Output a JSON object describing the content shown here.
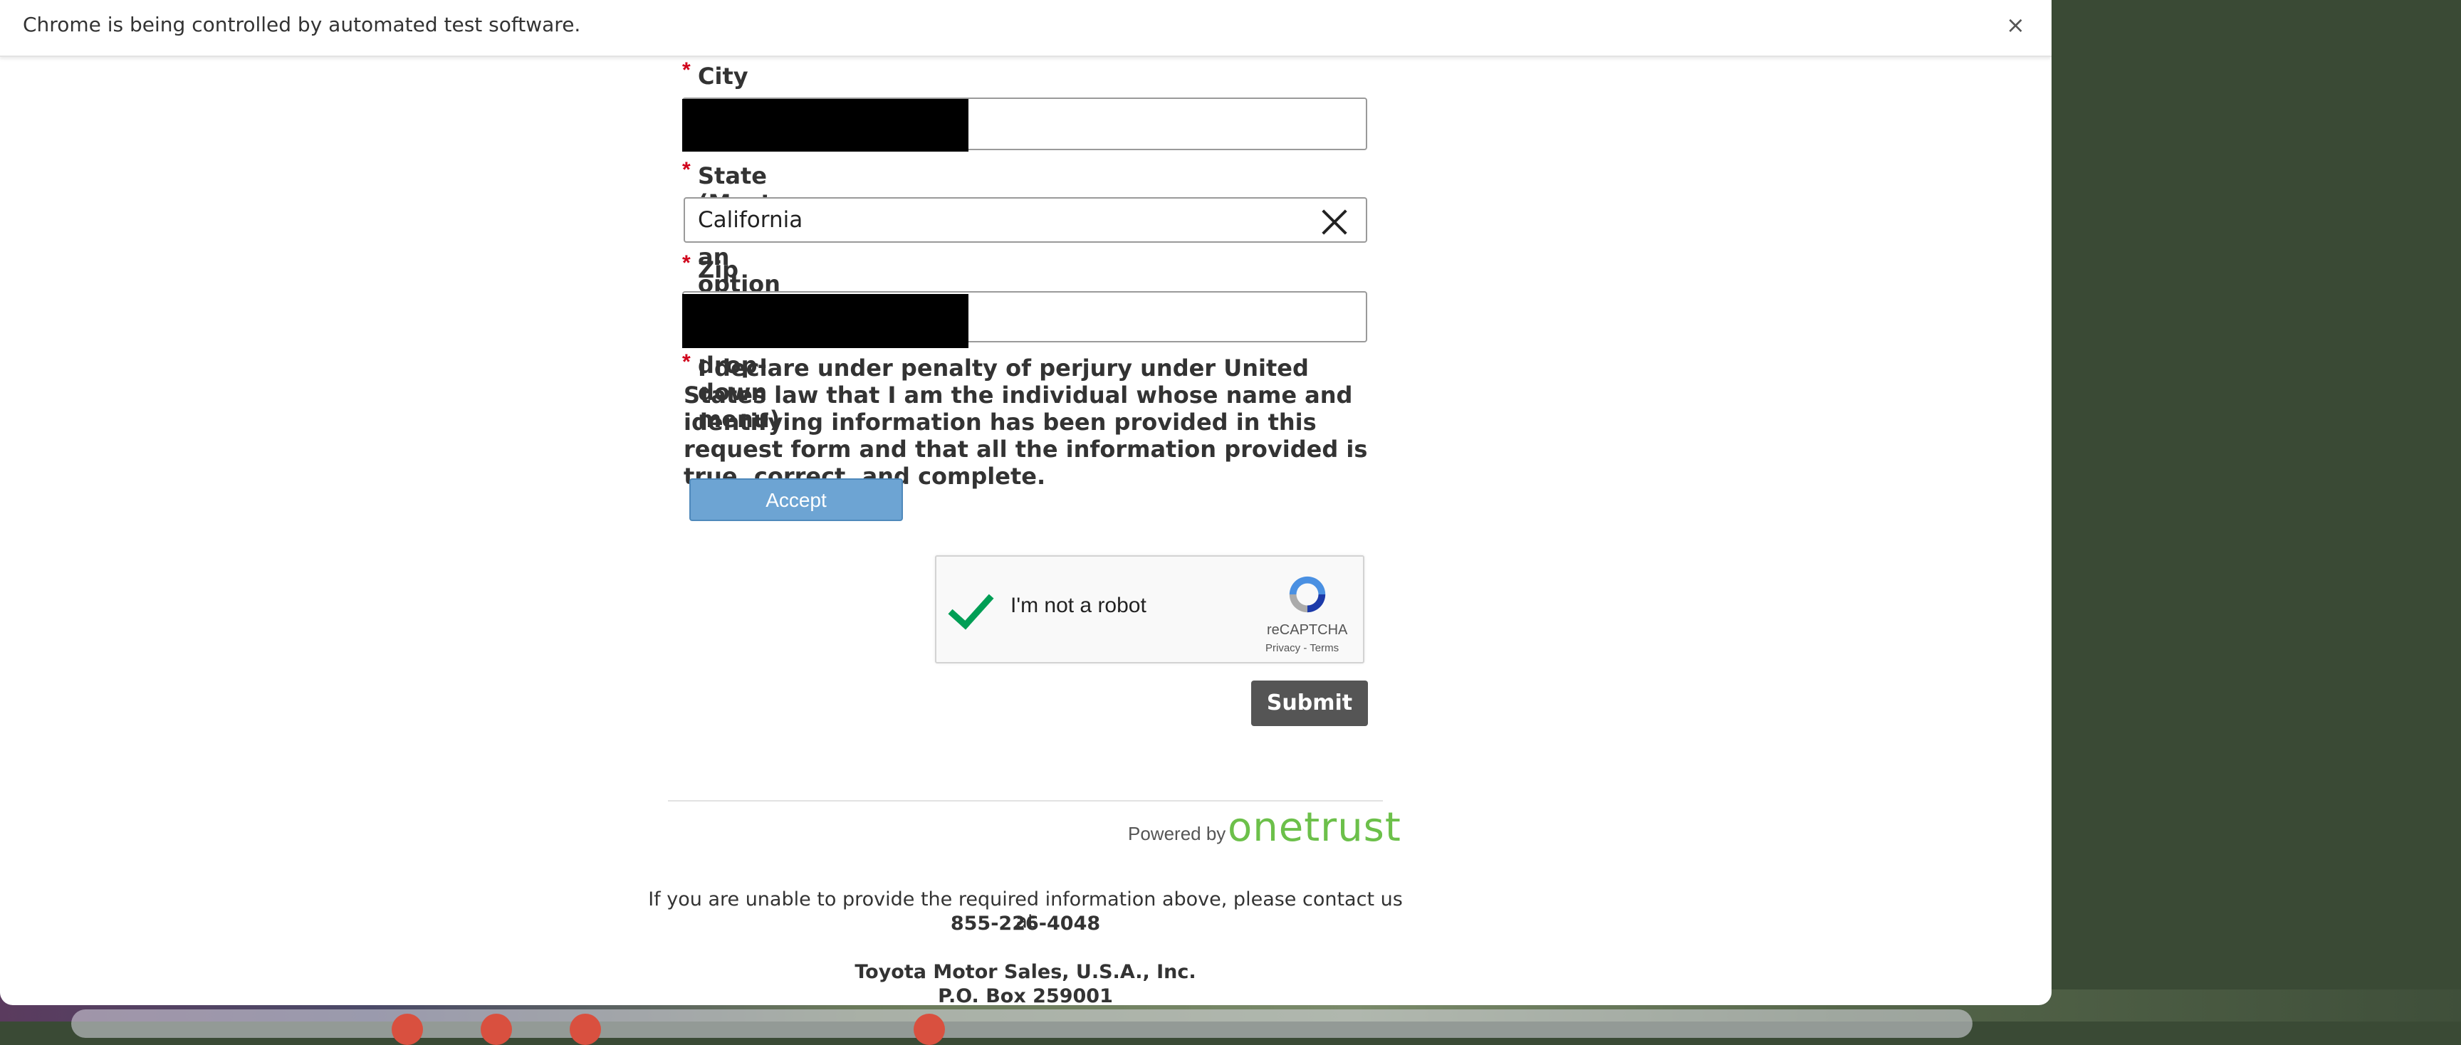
{
  "infobar": {
    "message": "Chrome is being controlled by automated test software.",
    "close_glyph": "×"
  },
  "form": {
    "required_marker": "*",
    "city": {
      "label": "City",
      "value": ""
    },
    "state": {
      "label": "State (Must select an option from the drop-down menu)",
      "value": "California"
    },
    "zip": {
      "label": "Zip",
      "value": ""
    },
    "declaration": "I declare under penalty of perjury under United States law that I am the individual whose name and identifying information has been provided in this request form and that all the information provided is true, correct, and complete.",
    "accept_label": "Accept",
    "recaptcha": {
      "checked": true,
      "label": "I'm not a robot",
      "brand": "reCAPTCHA",
      "links": "Privacy - Terms"
    },
    "submit_label": "Submit"
  },
  "footer": {
    "powered_by": "Powered by",
    "brand": "onetrust",
    "contact_text": "If you are unable to provide the required information above, please contact us at",
    "phone": "855-226-4048",
    "company": "Toyota Motor Sales, U.S.A., Inc.",
    "po_box": "P.O. Box 259001"
  },
  "colors": {
    "required": "#d0021b",
    "accept_button": "#6da4d3",
    "submit_button": "#555555",
    "onetrust_green": "#6cc04a",
    "recaptcha_check": "#009e55"
  },
  "icons": [
    "close-icon",
    "clear-selection-icon",
    "checkmark-icon",
    "recaptcha-logo-icon"
  ]
}
